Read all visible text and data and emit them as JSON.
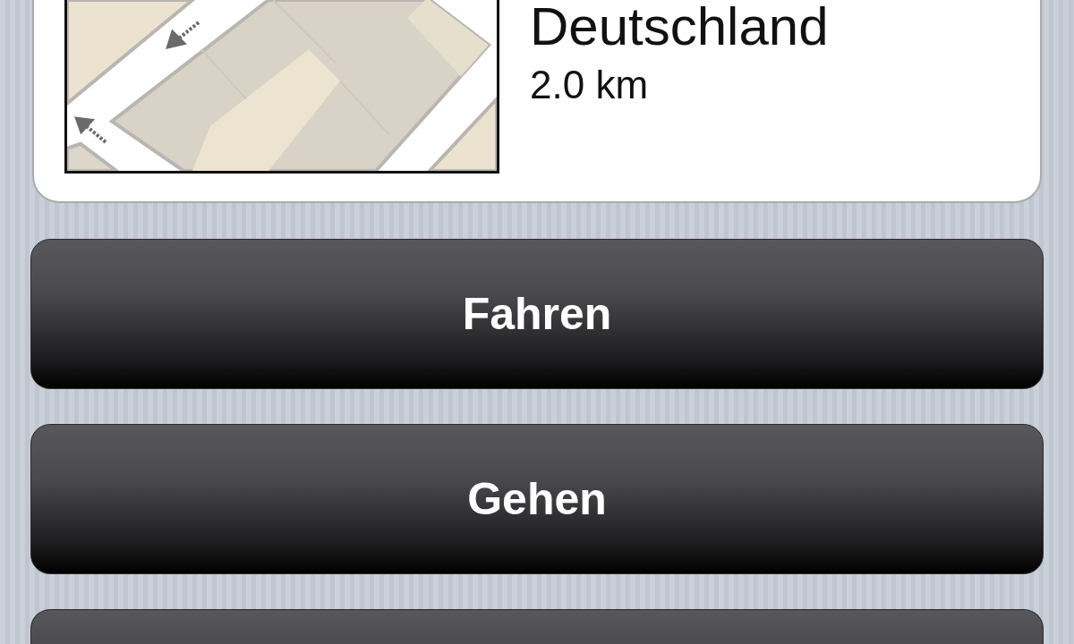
{
  "place": {
    "address_line": "Deutschland",
    "distance": "2.0 km"
  },
  "buttons": [
    {
      "label": "Fahren"
    },
    {
      "label": "Gehen"
    }
  ],
  "next_button_cut_off": true
}
